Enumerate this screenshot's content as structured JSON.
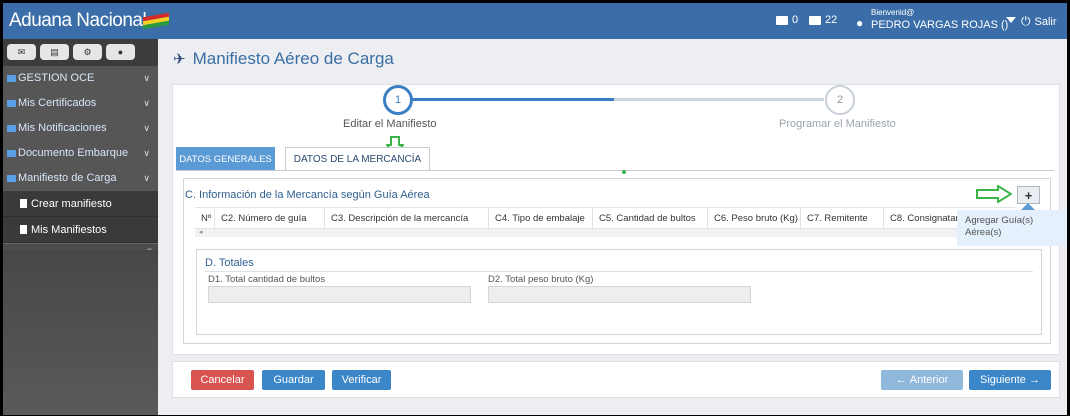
{
  "app": {
    "brand": "Aduana Nacional"
  },
  "topbar": {
    "inbox_count": "0",
    "mail_count": "22",
    "welcome": "Bienvenid@",
    "user_name": "PEDRO VARGAS ROJAS ()",
    "logout_label": "Salir"
  },
  "sidebar": {
    "items": [
      {
        "label": "GESTION OCE"
      },
      {
        "label": "Mis Certificados"
      },
      {
        "label": "Mis Notificaciones"
      },
      {
        "label": "Documento Embarque"
      },
      {
        "label": "Manifiesto de Carga"
      }
    ],
    "subitems": [
      {
        "label": "Crear manifiesto"
      },
      {
        "label": "Mis Manifiestos"
      }
    ],
    "collapse_glyph": "«"
  },
  "page": {
    "title": "Manifiesto Aéreo de Carga"
  },
  "wizard": {
    "steps": [
      {
        "number": "1",
        "label": "Editar el Manifiesto"
      },
      {
        "number": "2",
        "label": "Programar el Manifiesto"
      }
    ]
  },
  "tabs": [
    {
      "label": "DATOS GENERALES"
    },
    {
      "label": "DATOS DE LA MERCANCÍA"
    }
  ],
  "section_c": {
    "title": "C. Información de la Mercancía según Guía Aérea",
    "add_label": "+",
    "columns": [
      "Nº",
      "C2. Número de guía",
      "C3. Descripción de la mercancía",
      "C4. Tipo de embalaje",
      "C5. Cantidad de bultos",
      "C6. Peso bruto (Kg)",
      "C7. Remitente",
      "C8. Consignatar"
    ],
    "tooltip": "Agregar Guía(s) Aérea(s)"
  },
  "section_d": {
    "title": "D. Totales",
    "field1_label": "D1. Total cantidad de bultos",
    "field1_value": "",
    "field2_label": "D2. Total peso bruto (Kg)",
    "field2_value": ""
  },
  "footer": {
    "cancel": "Cancelar",
    "save": "Guardar",
    "verify": "Verificar",
    "prev": "Anterior",
    "next": "Siguiente"
  },
  "colors": {
    "topbar": "#3b6ea8",
    "accent": "#3a86c8",
    "danger": "#d9534f",
    "green_arrow": "#3bb44a"
  }
}
